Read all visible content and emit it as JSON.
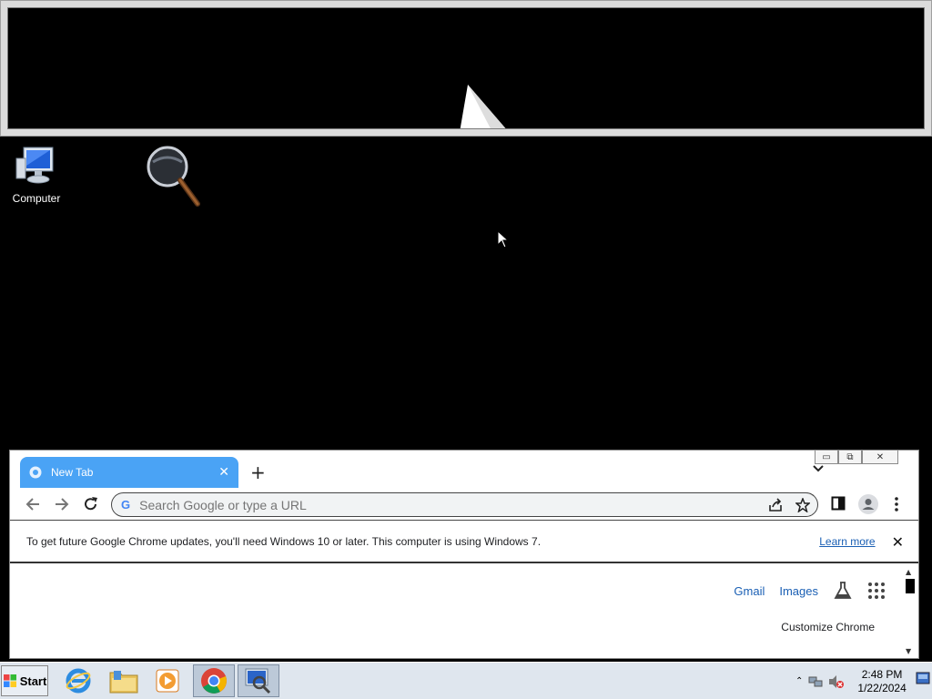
{
  "desktop": {
    "icons": [
      {
        "label": "Computer"
      },
      {
        "label": ""
      }
    ]
  },
  "chrome": {
    "tab_title": "New Tab",
    "new_tab_symbol": "+",
    "omnibox_placeholder": "Search Google or type a URL",
    "omnibox_logo": "G",
    "infobar_message": "To get future Google Chrome updates, you'll need Windows 10 or later. This computer is using Windows 7.",
    "infobar_link": "Learn more",
    "links": {
      "gmail": "Gmail",
      "images": "Images"
    },
    "customize": "Customize Chrome",
    "accent": "#4aa3f5"
  },
  "taskbar": {
    "start_label": "Start",
    "apps": [
      "internet-explorer",
      "file-explorer",
      "media-player",
      "chrome",
      "magnifier"
    ],
    "clock_time": "2:48 PM",
    "clock_date": "1/22/2024"
  }
}
